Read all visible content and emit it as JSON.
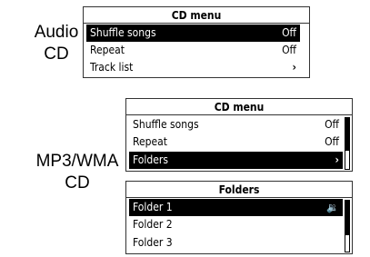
{
  "captions": {
    "audio_cd": [
      "Audio",
      "CD"
    ],
    "mp3_cd": [
      "MP3/WMA",
      "CD"
    ]
  },
  "audio_menu": {
    "title": "CD menu",
    "items": [
      {
        "label": "Shuffle songs",
        "value": "Off",
        "selected": true
      },
      {
        "label": "Repeat",
        "value": "Off",
        "selected": false
      },
      {
        "label": "Track list",
        "value": "›",
        "selected": false
      }
    ]
  },
  "mp3_menu": {
    "title": "CD menu",
    "items": [
      {
        "label": "Shuffle songs",
        "value": "Off",
        "selected": false
      },
      {
        "label": "Repeat",
        "value": "Off",
        "selected": false
      },
      {
        "label": "Folders",
        "value": "›",
        "selected": true
      }
    ]
  },
  "folders_menu": {
    "title": "Folders",
    "items": [
      {
        "label": "Folder 1",
        "icon": "speaker-icon",
        "selected": true
      },
      {
        "label": "Folder 2",
        "selected": false
      },
      {
        "label": "Folder 3",
        "selected": false
      }
    ]
  }
}
